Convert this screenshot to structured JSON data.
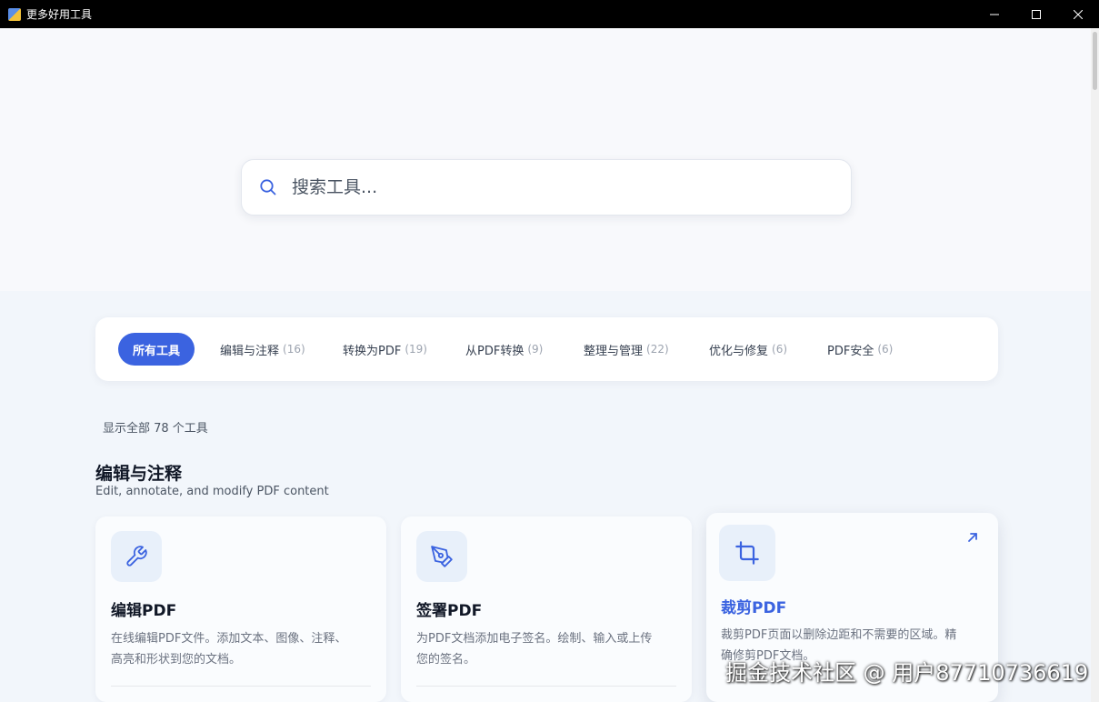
{
  "window": {
    "title": "更多好用工具"
  },
  "search": {
    "placeholder": "搜索工具..."
  },
  "tabs": [
    {
      "label": "所有工具",
      "count": ""
    },
    {
      "label": "编辑与注释",
      "count": "(16)"
    },
    {
      "label": "转换为PDF",
      "count": "(19)"
    },
    {
      "label": "从PDF转换",
      "count": "(9)"
    },
    {
      "label": "整理与管理",
      "count": "(22)"
    },
    {
      "label": "优化与修复",
      "count": "(6)"
    },
    {
      "label": "PDF安全",
      "count": "(6)"
    }
  ],
  "summary": "显示全部 78 个工具",
  "section": {
    "title": "编辑与注释",
    "subtitle": "Edit, annotate, and modify PDF content"
  },
  "cards": [
    {
      "icon": "wrench-icon",
      "title": "编辑PDF",
      "desc1": "在线编辑PDF文件。添加文本、图像、注释、",
      "desc2": "高亮和形状到您的文档。"
    },
    {
      "icon": "pen-nib-icon",
      "title": "签署PDF",
      "desc1": "为PDF文档添加电子签名。绘制、输入或上传",
      "desc2": "您的签名。"
    },
    {
      "icon": "crop-icon",
      "title": "裁剪PDF",
      "desc1": "裁剪PDF页面以删除边距和不需要的区域。精",
      "desc2": "确修剪PDF文档。"
    }
  ],
  "watermark": "掘金技术社区 @ 用户87710736619",
  "colors": {
    "accent": "#3b63e0",
    "background": "#f2f6fb"
  }
}
